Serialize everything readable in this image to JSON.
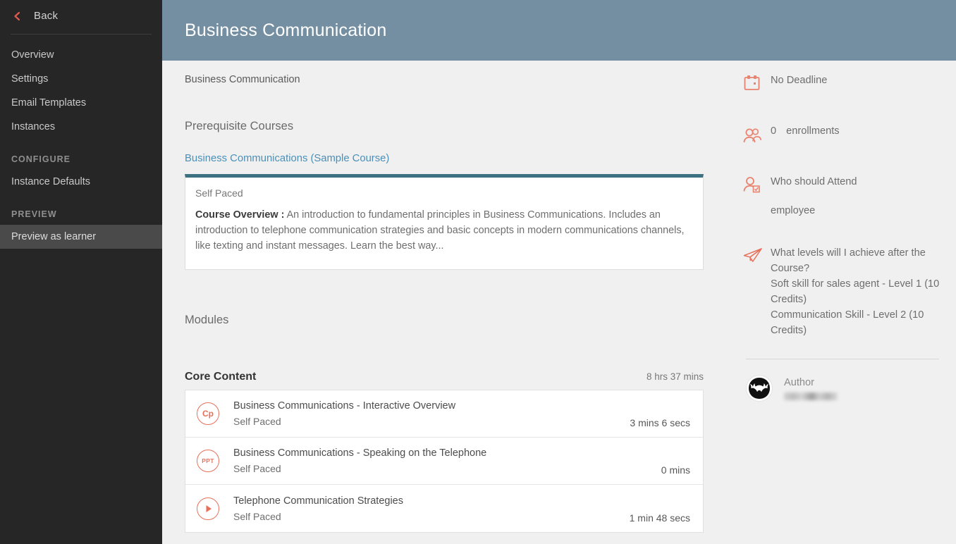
{
  "sidebar": {
    "back_label": "Back",
    "items": [
      {
        "label": "Overview",
        "active": false
      },
      {
        "label": "Settings",
        "active": false
      },
      {
        "label": "Email Templates",
        "active": false
      },
      {
        "label": "Instances",
        "active": false
      }
    ],
    "configure_header": "CONFIGURE",
    "configure_items": [
      {
        "label": "Instance Defaults",
        "active": false
      }
    ],
    "preview_header": "PREVIEW",
    "preview_items": [
      {
        "label": "Preview as learner",
        "active": true
      }
    ]
  },
  "header": {
    "title": "Business Communication"
  },
  "main": {
    "breadcrumb": "Business Communication",
    "prerequisite_title": "Prerequisite Courses",
    "prerequisite_link": "Business Communications (Sample Course)",
    "prerequisite_card": {
      "pacing": "Self Paced",
      "overview_label": "Course Overview :",
      "overview_text": " An introduction to fundamental principles in Business Communications. Includes an introduction to telephone communication strategies and basic concepts in modern communications channels, like texting and instant messages. Learn the best way..."
    },
    "modules_title": "Modules",
    "module_group": {
      "name": "Core Content",
      "duration": "8 hrs 37 mins",
      "rows": [
        {
          "icon": "captivate-icon",
          "icon_label": "Cp",
          "title": "Business Communications - Interactive Overview",
          "pacing": "Self Paced",
          "duration": "3 mins 6 secs"
        },
        {
          "icon": "powerpoint-icon",
          "icon_label": "PPT",
          "title": "Business Communications - Speaking on the Telephone",
          "pacing": "Self Paced",
          "duration": "0 mins"
        },
        {
          "icon": "play-icon",
          "icon_label": "",
          "title": "Telephone Communication Strategies",
          "pacing": "Self Paced",
          "duration": "1 min 48 secs"
        }
      ]
    }
  },
  "right_panel": {
    "deadline": "No Deadline",
    "enrollments_count": "0",
    "enrollments_label": "enrollments",
    "attend_title": "Who should Attend",
    "attend_value": "employee",
    "levels_question": "What levels will I achieve after the Course?",
    "levels": [
      "Soft skill for sales agent - Level 1 (10 Credits)",
      "Communication Skill - Level 2 (10 Credits)"
    ],
    "author_label": "Author",
    "author_name": ""
  },
  "colors": {
    "sidebar_bg": "#262626",
    "header_bg": "#748fa1",
    "accent_coral": "#e8705a",
    "accent_teal": "#3d7080",
    "link_blue": "#4a90b8",
    "page_bg": "#f0f0f0"
  }
}
